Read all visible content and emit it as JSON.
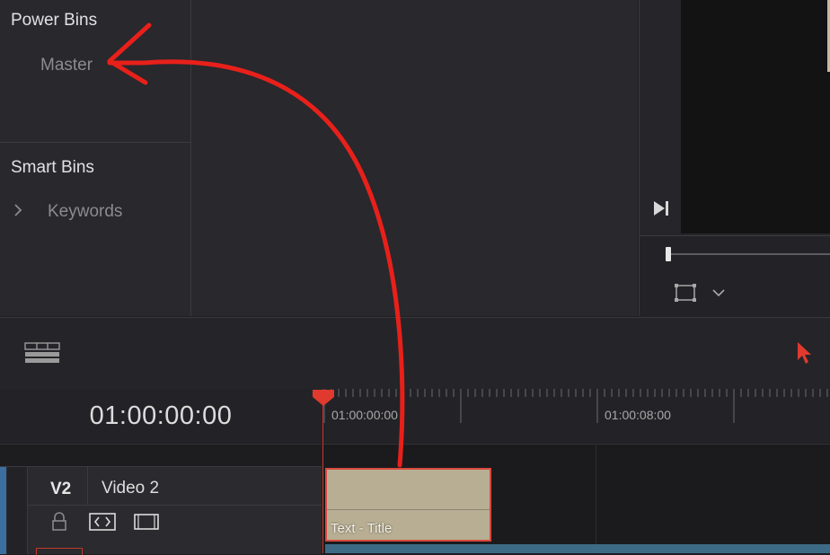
{
  "bins": {
    "power_bins_heading": "Power Bins",
    "master_item": "Master",
    "smart_bins_heading": "Smart Bins",
    "keywords_item": "Keywords"
  },
  "timeline": {
    "timecode": "01:00:00:00",
    "ruler_labels": [
      "01:00:00:00",
      "01:00:08:00"
    ]
  },
  "track": {
    "id": "V2",
    "name": "Video 2"
  },
  "clip": {
    "label": "Text - Title"
  },
  "colors": {
    "accent_red": "#e03a2e",
    "clip_fill": "#b8ae93",
    "annotation_arrow": "#e8201a"
  }
}
